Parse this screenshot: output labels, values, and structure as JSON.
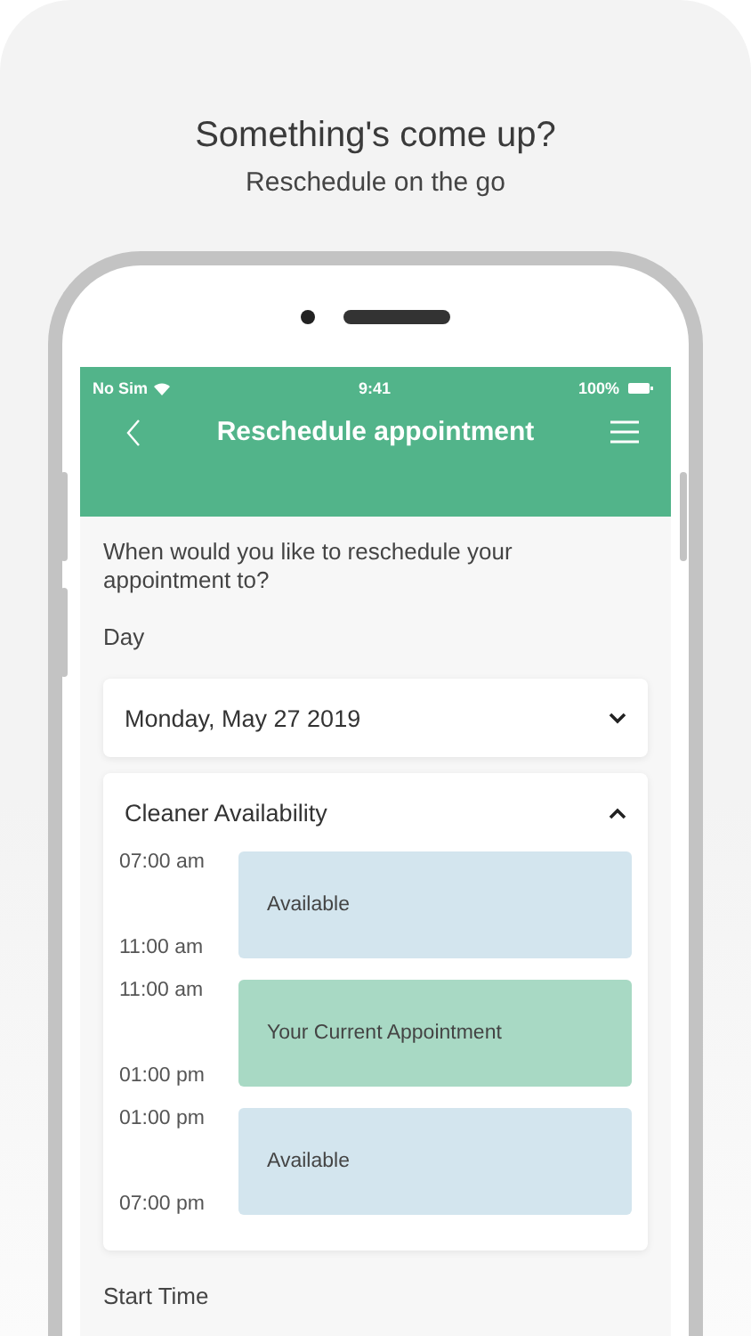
{
  "headline": "Something's come up?",
  "subheadline": "Reschedule on the go",
  "status_bar": {
    "carrier": "No Sim",
    "time": "9:41",
    "battery": "100%"
  },
  "nav": {
    "title": "Reschedule appointment"
  },
  "prompt": "When would you like to reschedule your appointment to?",
  "day": {
    "label": "Day",
    "value": "Monday, May 27 2019",
    "expanded": false
  },
  "availability": {
    "title": "Cleaner Availability",
    "expanded": true,
    "slots": [
      {
        "start": "07:00 am",
        "end": "11:00 am",
        "label": "Available",
        "kind": "available"
      },
      {
        "start": "11:00 am",
        "end": "01:00 pm",
        "label": "Your Current Appointment",
        "kind": "current"
      },
      {
        "start": "01:00 pm",
        "end": "07:00 pm",
        "label": "Available",
        "kind": "available"
      }
    ]
  },
  "start_time": {
    "label": "Start Time"
  }
}
